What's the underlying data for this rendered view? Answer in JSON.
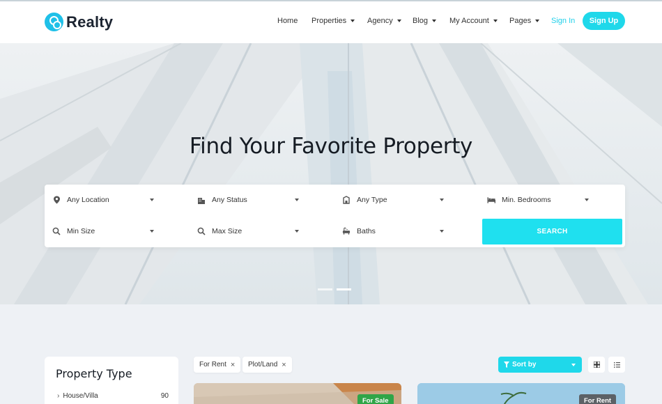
{
  "brand": {
    "name": "Realty",
    "accent": "#1fd8ea"
  },
  "nav": {
    "items": [
      {
        "label": "Home",
        "dropdown": false
      },
      {
        "label": "Properties",
        "dropdown": true
      },
      {
        "label": "Agency",
        "dropdown": true
      },
      {
        "label": "Blog",
        "dropdown": true
      },
      {
        "label": "My Account",
        "dropdown": true
      },
      {
        "label": "Pages",
        "dropdown": true
      }
    ],
    "sign_in": "Sign In",
    "sign_up": "Sign Up"
  },
  "hero": {
    "title": "Find Your Favorite Property",
    "slides": 2,
    "active_slide": 2
  },
  "search": {
    "fields": [
      {
        "label": "Any Location",
        "icon": "map-pin-icon"
      },
      {
        "label": "Any Status",
        "icon": "building-icon"
      },
      {
        "label": "Any Type",
        "icon": "house-icon"
      },
      {
        "label": "Min. Bedrooms",
        "icon": "bed-icon"
      },
      {
        "label": "Min Size",
        "icon": "search-icon"
      },
      {
        "label": "Max Size",
        "icon": "search-icon"
      },
      {
        "label": "Baths",
        "icon": "bath-icon"
      }
    ],
    "button": "SEARCH"
  },
  "sidebar": {
    "title": "Property Type",
    "items": [
      {
        "label": "House/Villa",
        "count": "90"
      }
    ]
  },
  "filters": {
    "tags": [
      {
        "label": "For Rent"
      },
      {
        "label": "Plot/Land"
      }
    ],
    "sort_label": "Sort by"
  },
  "view_modes": [
    "grid-icon",
    "list-icon"
  ],
  "listings": [
    {
      "badge": "For Sale",
      "badge_color": "#2fa548"
    },
    {
      "badge": "For Rent",
      "badge_color": "#5c6166"
    }
  ]
}
